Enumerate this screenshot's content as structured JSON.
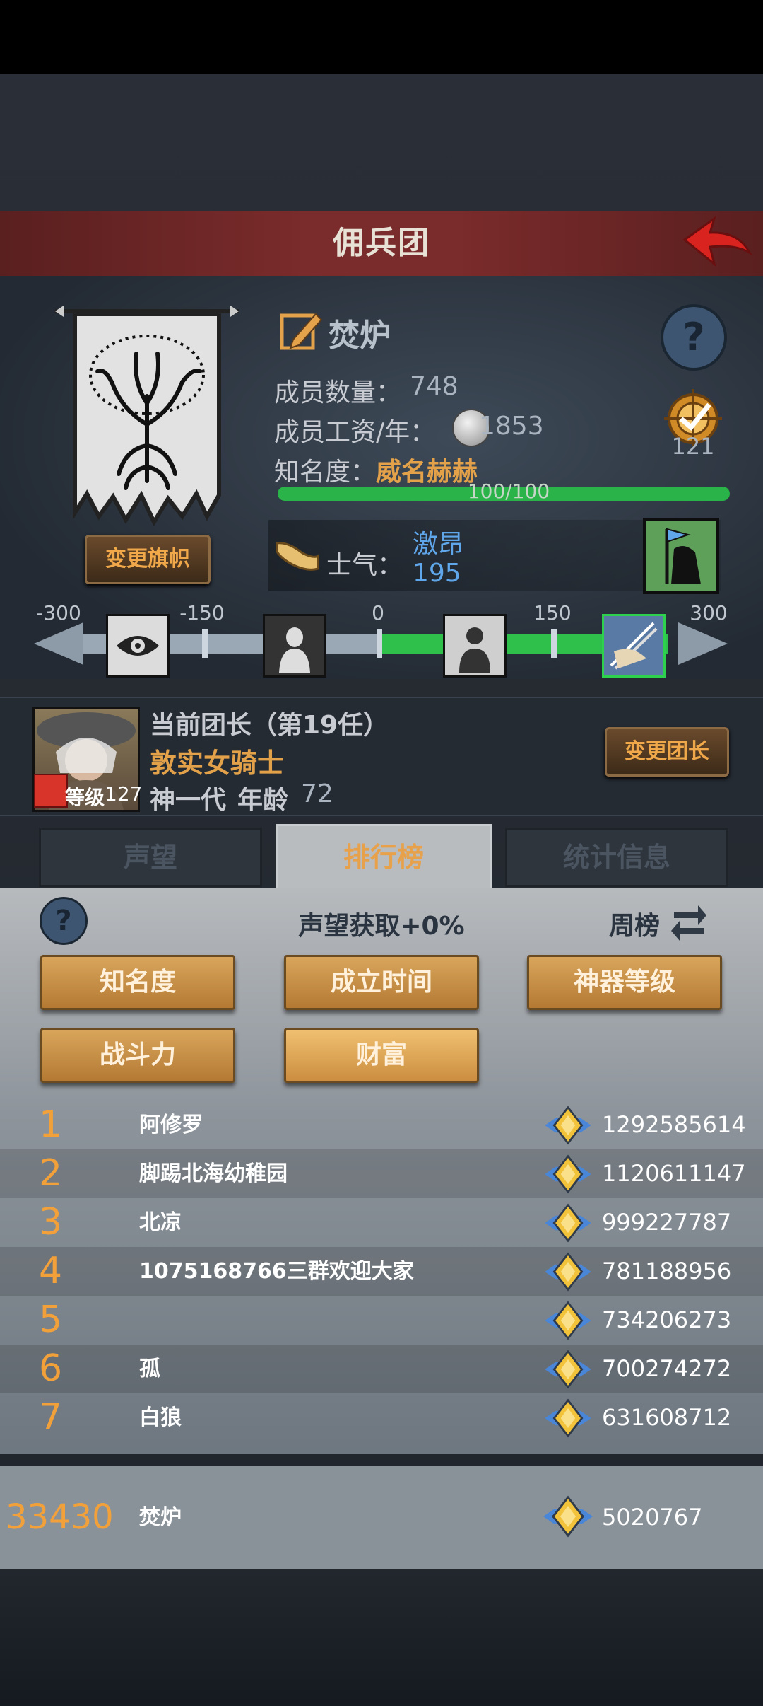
{
  "header": {
    "title": "佣兵团"
  },
  "guild": {
    "name": "焚炉",
    "members_label": "成员数量：",
    "members": "748",
    "wage_label": "成员工资/年：",
    "wage": "1853",
    "fame_label": "知名度：",
    "fame_value": "威名赫赫",
    "fame_progress_text": "100/100",
    "fame_progress": 1.0,
    "badge_count": "121",
    "change_flag_label": "变更旗帜"
  },
  "morale": {
    "label": "士气：",
    "state": "激昂",
    "value": "195",
    "scale_ticks": [
      "-300",
      "-150",
      "0",
      "150",
      "300"
    ]
  },
  "leader": {
    "title": "当前团长（第19任）",
    "name": "敦实女骑士",
    "level_label": "等级",
    "level": "127",
    "generation": "神一代",
    "age_label": "年龄",
    "age": "72",
    "change_leader_label": "变更团长"
  },
  "tabs": [
    {
      "label": "声望"
    },
    {
      "label": "排行榜"
    },
    {
      "label": "统计信息"
    }
  ],
  "ranking": {
    "bonus_text": "声望获取+0%",
    "period_label": "周榜",
    "filters": [
      {
        "label": "知名度"
      },
      {
        "label": "成立时间"
      },
      {
        "label": "神器等级"
      },
      {
        "label": "战斗力"
      },
      {
        "label": "财富"
      }
    ],
    "rows": [
      {
        "rank": "1",
        "name": "阿修罗",
        "value": "1292585614"
      },
      {
        "rank": "2",
        "name": "脚踢北海幼稚园",
        "value": "1120611147"
      },
      {
        "rank": "3",
        "name": "北凉",
        "value": "999227787"
      },
      {
        "rank": "4",
        "name": "1075168766三群欢迎大家",
        "value": "781188956"
      },
      {
        "rank": "5",
        "name": "",
        "value": "734206273"
      },
      {
        "rank": "6",
        "name": "孤",
        "value": "700274272"
      },
      {
        "rank": "7",
        "name": "白狼",
        "value": "631608712"
      }
    ],
    "mine": {
      "rank": "33430",
      "name": "焚炉",
      "value": "5020767"
    }
  },
  "colors": {
    "accent_orange": "#f2a13a",
    "green_bar": "#29b348",
    "title_red": "#7a2b2b"
  }
}
